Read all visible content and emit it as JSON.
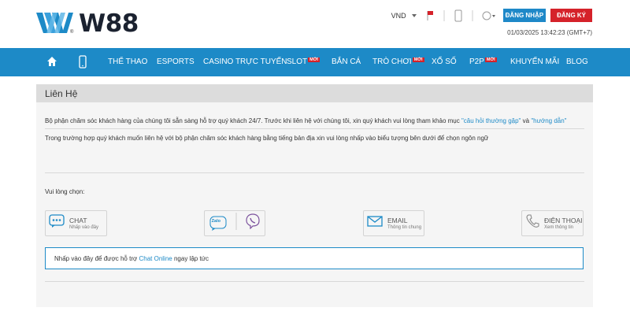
{
  "header": {
    "brand": "W88",
    "currency": "VND",
    "login_label": "ĐĂNG NHẬP",
    "register_label": "ĐĂNG KÝ",
    "datetime": "01/03/2025 13:42:23 (GMT+7)"
  },
  "nav": {
    "items": [
      {
        "label": "THỂ THAO"
      },
      {
        "label": "ESPORTS"
      },
      {
        "label": "CASINO TRỰC TUYẾN"
      },
      {
        "label": "SLOT",
        "badge": "MỚI"
      },
      {
        "label": "BẮN CÁ"
      },
      {
        "label": "TRÒ CHƠI",
        "badge": "MỚI"
      },
      {
        "label": "XỔ SỐ"
      },
      {
        "label": "P2P",
        "badge": "MỚI"
      },
      {
        "label": "KHUYẾN MÃI"
      },
      {
        "label": "BLOG"
      }
    ]
  },
  "page": {
    "title": "Liên Hệ",
    "intro_part1": "Bộ phận chăm sóc khách hàng của chúng tôi sẵn sàng hỗ trợ quý khách 24/7. Trước khi liên hệ với chúng tôi, xin quý khách vui lòng tham khảo mục ",
    "faq_link": "\"câu hỏi thường gặp\"",
    "intro_and": " và ",
    "guide_link": "\"hướng dẫn\"",
    "intro2": "Trong trường hợp quý khách muốn liên hệ với bộ phận chăm sóc khách hàng bằng tiếng bản địa xin vui lòng nhấp vào biểu tượng bên dưới để chọn ngôn ngữ",
    "choose_label": "Vui lòng chọn:",
    "options": {
      "chat": {
        "title": "CHAT",
        "sub": "Nhấp vào đây"
      },
      "zalo": {
        "title": "Zalo"
      },
      "email": {
        "title": "EMAIL",
        "sub": "Thông tin chung"
      },
      "phone": {
        "title": "ĐIỆN THOẠI",
        "sub": "Xem thông tin"
      }
    },
    "chat_prompt_part1": "Nhấp vào đây để được hỗ trợ ",
    "chat_prompt_link": "Chat Online",
    "chat_prompt_part2": " ngay lập tức"
  },
  "colors": {
    "primary_blue": "#1d8ac7",
    "register_red": "#d5222a",
    "title_bar_gray": "#dcdcdc"
  }
}
